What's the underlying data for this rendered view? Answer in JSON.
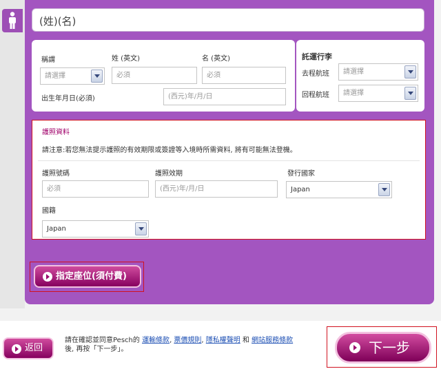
{
  "name_header": "(姓)(名)",
  "passenger": {
    "title_label": "稱謂",
    "title_select": "請選擇",
    "surname_label": "姓 (英文)",
    "surname_placeholder": "必須",
    "givenname_label": "名 (英文)",
    "givenname_placeholder": "必須",
    "birthdate_label": "出生年月日(必須)",
    "birthdate_placeholder": "(西元)年/月/日"
  },
  "baggage": {
    "title": "託運行李",
    "outbound_label": "去程航班",
    "outbound_select": "請選擇",
    "return_label": "回程航班",
    "return_select": "請選擇"
  },
  "passport": {
    "title": "護照資料",
    "note": "請注意:若您無法提示護照的有效期限或簽證等入境時所需資料, 將有可能無法登機。",
    "number_label": "護照號碼",
    "number_placeholder": "必須",
    "expiry_label": "護照效期",
    "expiry_placeholder": "(西元)年/月/日",
    "issuing_label": "發行國家",
    "issuing_value": "Japan",
    "nationality_label": "國籍",
    "nationality_value": "Japan"
  },
  "seat_button": "指定座位(須付費)",
  "footer": {
    "back_button": "返回",
    "terms_prefix": "請在確認並同意Pesch的 ",
    "link_carriage": "運輸條款",
    "sep1": ", ",
    "link_fare": "票價規則",
    "sep2": ", ",
    "link_privacy": "隱私權聲明",
    "and": " 和 ",
    "link_site": "網站服務條款",
    "terms_suffix": "後, 再按「下一步」。",
    "next_button": "下一步"
  }
}
